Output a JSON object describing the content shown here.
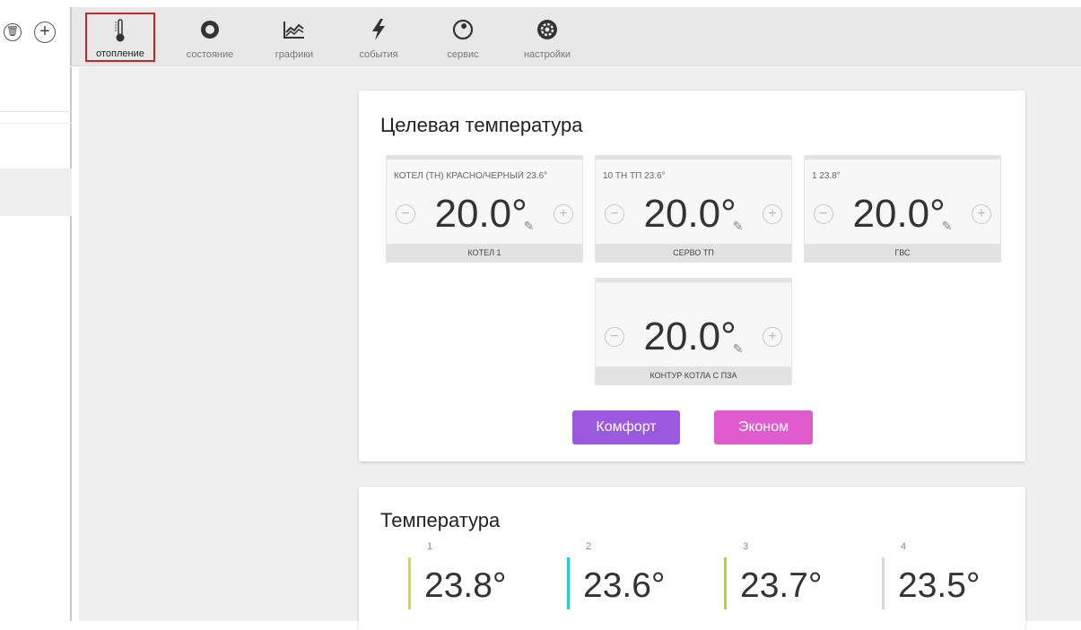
{
  "toolbar": {
    "tabs": [
      {
        "label": "отопление",
        "icon": "thermometer-icon"
      },
      {
        "label": "состояние",
        "icon": "circle-status-icon"
      },
      {
        "label": "графики",
        "icon": "chart-icon"
      },
      {
        "label": "события",
        "icon": "lightning-icon"
      },
      {
        "label": "сервис",
        "icon": "wrench-icon"
      },
      {
        "label": "настройки",
        "icon": "gear-icon"
      }
    ]
  },
  "target_card": {
    "title": "Целевая температура",
    "widgets": [
      {
        "header": "КОТЕЛ (ТН) КРАСНО/ЧЕРНЫЙ   23.6°",
        "value": "20.0°",
        "footer": "КОТЕЛ 1"
      },
      {
        "header": "10 ТН ТП   23.6°",
        "value": "20.0°",
        "footer": "СЕРВО ТП"
      },
      {
        "header": "1   23.8°",
        "value": "20.0°",
        "footer": "ГВС"
      },
      {
        "header": "",
        "value": "20.0°",
        "footer": "КОНТУР КОТЛА С ПЗА"
      }
    ],
    "buttons": {
      "comfort": "Комфорт",
      "econom": "Эконом"
    }
  },
  "temp_card": {
    "title": "Температура",
    "sensors": [
      {
        "index": "1",
        "value": "23.8°",
        "color": "#d4dc2a"
      },
      {
        "index": "2",
        "value": "23.6°",
        "color": "#27c8d4"
      },
      {
        "index": "3",
        "value": "23.7°",
        "color": "#b5d42a"
      },
      {
        "index": "4",
        "value": "23.5°",
        "color": "#d8d8d8"
      }
    ]
  },
  "colors": {
    "comfort": "#9b59e0",
    "econom": "#e05cce",
    "active_tab_border": "#c62828"
  }
}
